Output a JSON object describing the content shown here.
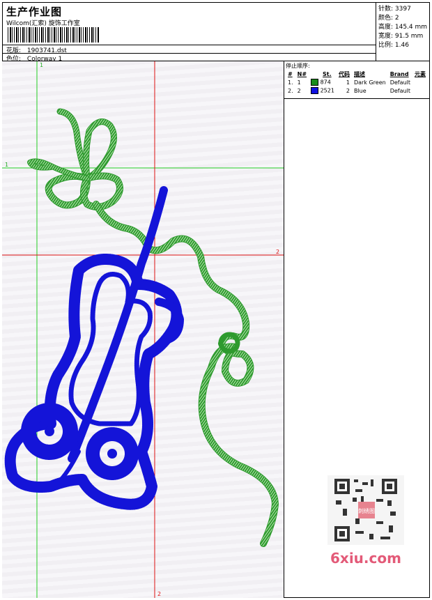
{
  "header": {
    "title": "生产作业图",
    "subtitle": "Wilcom(汇索) 旋饰工作室",
    "pattern_label": "花版:",
    "pattern_value": "1903741.dst",
    "colorway_label": "色位:",
    "colorway_value": "Colorway 1"
  },
  "stats": {
    "stitches": "针数: 3397",
    "colors": "颜色: 2",
    "height": "高度: 145.4 mm",
    "width": "宽度: 91.5 mm",
    "scale": "比例: 1.46"
  },
  "stop_sequence": {
    "heading": "停止顺序:",
    "columns": [
      "#",
      "N#",
      "St.",
      "代码",
      "描述",
      "Brand",
      "元素"
    ],
    "rows": [
      {
        "num": "1.",
        "needle": "1",
        "color": "#1a8c1a",
        "stitches": "874",
        "code": "1",
        "description": "Dark Green",
        "brand": "Default"
      },
      {
        "num": "2.",
        "needle": "2",
        "color": "#1010e0",
        "stitches": "2521",
        "code": "2",
        "description": "Blue",
        "brand": "Default"
      }
    ]
  },
  "guides": {
    "v_green_label": "1",
    "h_green_label": "1",
    "h_red_label": "2",
    "v_red_label": "2"
  },
  "watermark": {
    "site": "6xiu.com",
    "stamp": "刺绣图"
  },
  "colors": {
    "green_guide": "#22cc22",
    "red_guide": "#dd1111",
    "thread_green": "#2e9a2e",
    "thread_blue": "#1414d8"
  }
}
